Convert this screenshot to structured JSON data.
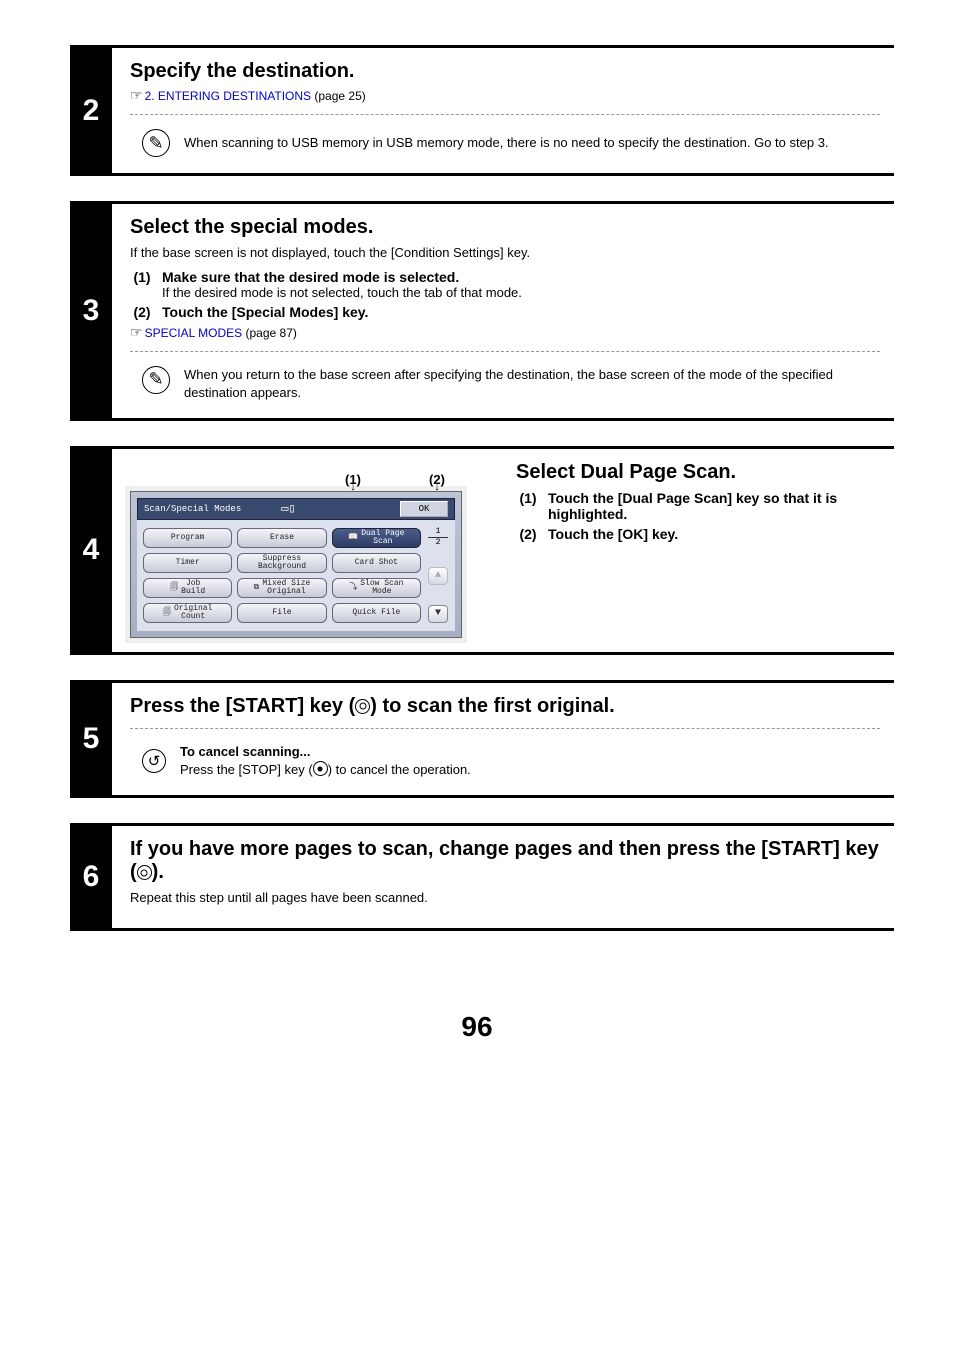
{
  "step2": {
    "title": "Specify the destination.",
    "link_text": "2. ENTERING DESTINATIONS",
    "link_page": " (page 25)",
    "note": "When scanning to USB memory in USB memory mode, there is no need to specify the destination. Go to step 3."
  },
  "step3": {
    "title": "Select the special modes.",
    "intro": "If the base screen is not displayed, touch the [Condition Settings] key.",
    "item1_label": "Make sure that the desired mode is selected.",
    "item1_desc": "If the desired mode is not selected, touch the tab of that mode.",
    "item2_label": "Touch the [Special Modes] key.",
    "link_text": "SPECIAL MODES",
    "link_page": " (page 87)",
    "note": "When you return to the base screen after specifying the destination, the base screen of the mode of the specified destination appears."
  },
  "step4": {
    "title": "Select Dual Page Scan.",
    "item1": "Touch the [Dual Page Scan] key so that it is highlighted.",
    "item2": "Touch the [OK] key.",
    "callout1": "(1)",
    "callout2": "(2)",
    "screen": {
      "header_title": "Scan/Special Modes",
      "ok": "OK",
      "page_top": "1",
      "page_bottom": "2",
      "btns": [
        "Program",
        "Erase",
        "Dual Page\nScan",
        "Timer",
        "Suppress\nBackground",
        "Card Shot",
        "Job\nBuild",
        "Mixed Size\nOriginal",
        "Slow Scan\nMode",
        "Original\nCount",
        "File",
        "Quick File"
      ]
    }
  },
  "step5": {
    "title_a": "Press the [START] key (",
    "title_b": ") to scan the first original.",
    "cancel_h": "To cancel scanning...",
    "cancel_t1": "Press the [STOP] key (",
    "cancel_t2": ") to cancel the operation."
  },
  "step6": {
    "title_a": "If you have more pages to scan, change pages and then press the [START] key (",
    "title_b": ").",
    "body": "Repeat this step until all pages have been scanned."
  },
  "page_number": "96",
  "labels": {
    "p1": "(1)",
    "p2": "(2)"
  }
}
